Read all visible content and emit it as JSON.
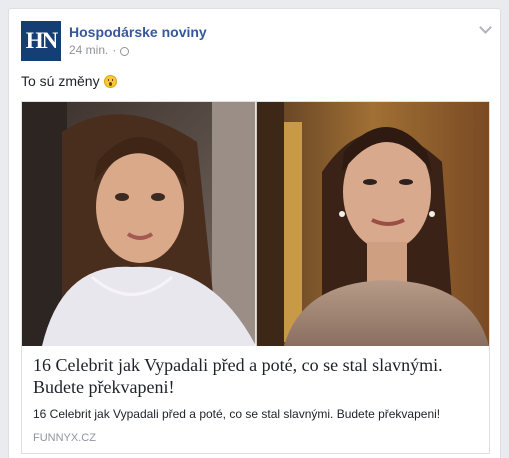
{
  "post": {
    "page_name": "Hospodárske noviny",
    "avatar_text": "HN",
    "time": "24 min.",
    "separator": "·",
    "privacy_icon": "globe-icon",
    "menu_icon": "chevron-down-icon",
    "text": "To sú změny",
    "emoji": "surprised-face-emoji"
  },
  "link_card": {
    "image_description_icon": "photo-collage-image",
    "title": "16 Celebrit jak Vypadali před a poté, co se stal slavnými. Budete překvapeni!",
    "description": "16 Celebrit jak Vypadali před a poté, co se stal slavnými. Budete překvapeni!",
    "domain": "FUNNYX.CZ"
  },
  "colors": {
    "brand_navy": "#153e74",
    "link_blue": "#365899",
    "meta_gray": "#90949c",
    "background": "#e9ebee"
  }
}
